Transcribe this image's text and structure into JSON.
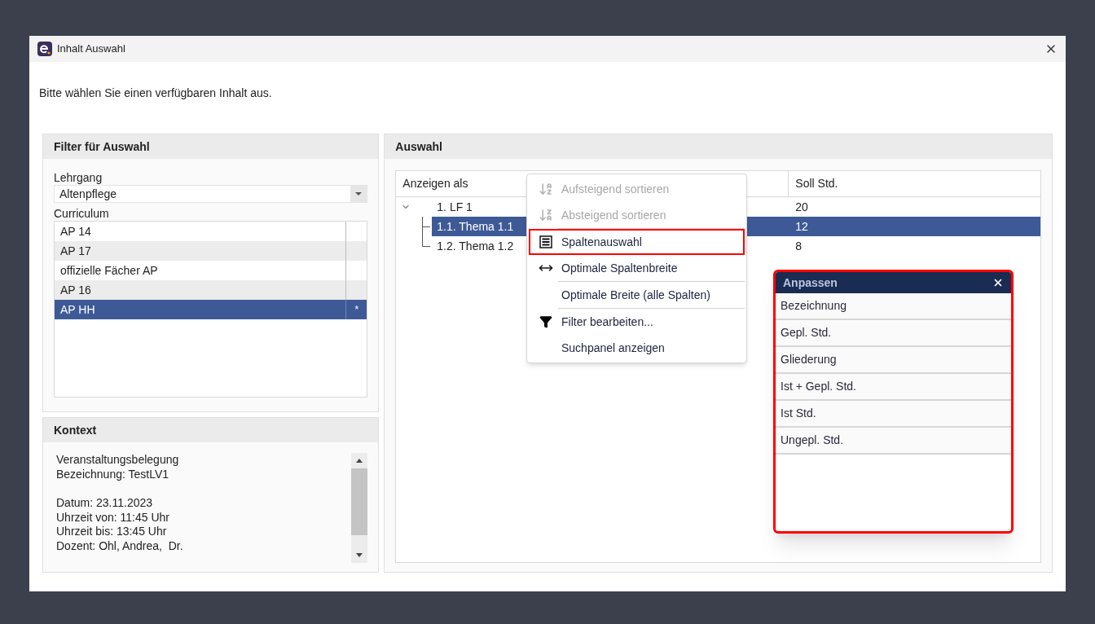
{
  "window": {
    "title": "Inhalt Auswahl"
  },
  "instruction": "Bitte wählen Sie einen verfügbaren Inhalt aus.",
  "filter_panel": {
    "title": "Filter für Auswahl",
    "lehrgang_label": "Lehrgang",
    "lehrgang_value": "Altenpflege",
    "curriculum_label": "Curriculum",
    "curriculum_items": [
      {
        "name": "AP 14",
        "marker": "",
        "selected": false
      },
      {
        "name": "AP 17",
        "marker": "",
        "selected": false
      },
      {
        "name": "offizielle Fächer AP",
        "marker": "",
        "selected": false
      },
      {
        "name": "AP 16",
        "marker": "",
        "selected": false
      },
      {
        "name": "AP HH",
        "marker": "*",
        "selected": true
      }
    ]
  },
  "context_panel": {
    "title": "Kontext",
    "paragraphs": [
      [
        "Veranstaltungsbelegung",
        "Bezeichnung: TestLV1"
      ],
      [
        "Datum: 23.11.2023",
        "Uhrzeit von: 11:45 Uhr",
        "Uhrzeit bis: 13:45 Uhr",
        "Dozent: Ohl, Andrea,  Dr."
      ]
    ]
  },
  "selection_panel": {
    "title": "Auswahl",
    "columns": [
      "Anzeigen als",
      "Soll Std."
    ],
    "rows": [
      {
        "label": "1. LF 1",
        "value": "20",
        "expanded": true,
        "selected": false,
        "children": [
          {
            "label": "1.1. Thema 1.1",
            "value": "12",
            "selected": true
          },
          {
            "label": "1.2. Thema 1.2",
            "value": "8",
            "selected": false
          }
        ]
      }
    ]
  },
  "context_menu": {
    "items": [
      {
        "kind": "sort-asc",
        "label": "Aufsteigend sortieren",
        "disabled": true,
        "highlighted": false
      },
      {
        "kind": "sort-desc",
        "label": "Absteigend sortieren",
        "disabled": true,
        "highlighted": false
      },
      {
        "kind": "separator"
      },
      {
        "kind": "columns",
        "label": "Spaltenauswahl",
        "disabled": false,
        "highlighted": true
      },
      {
        "kind": "fit-width",
        "label": "Optimale Spaltenbreite",
        "disabled": false,
        "highlighted": false
      },
      {
        "kind": "separator"
      },
      {
        "kind": "plain",
        "label": "Optimale Breite (alle Spalten)",
        "disabled": false,
        "highlighted": false
      },
      {
        "kind": "separator"
      },
      {
        "kind": "filter",
        "label": "Filter bearbeiten...",
        "disabled": false,
        "highlighted": false
      },
      {
        "kind": "plain",
        "label": "Suchpanel anzeigen",
        "disabled": false,
        "highlighted": false
      }
    ]
  },
  "customize_dialog": {
    "title": "Anpassen",
    "highlighted": true,
    "items": [
      "Bezeichnung",
      "Gepl. Std.",
      "Gliederung",
      "Ist + Gepl. Std.",
      "Ist Std.",
      "Ungepl. Std."
    ]
  }
}
